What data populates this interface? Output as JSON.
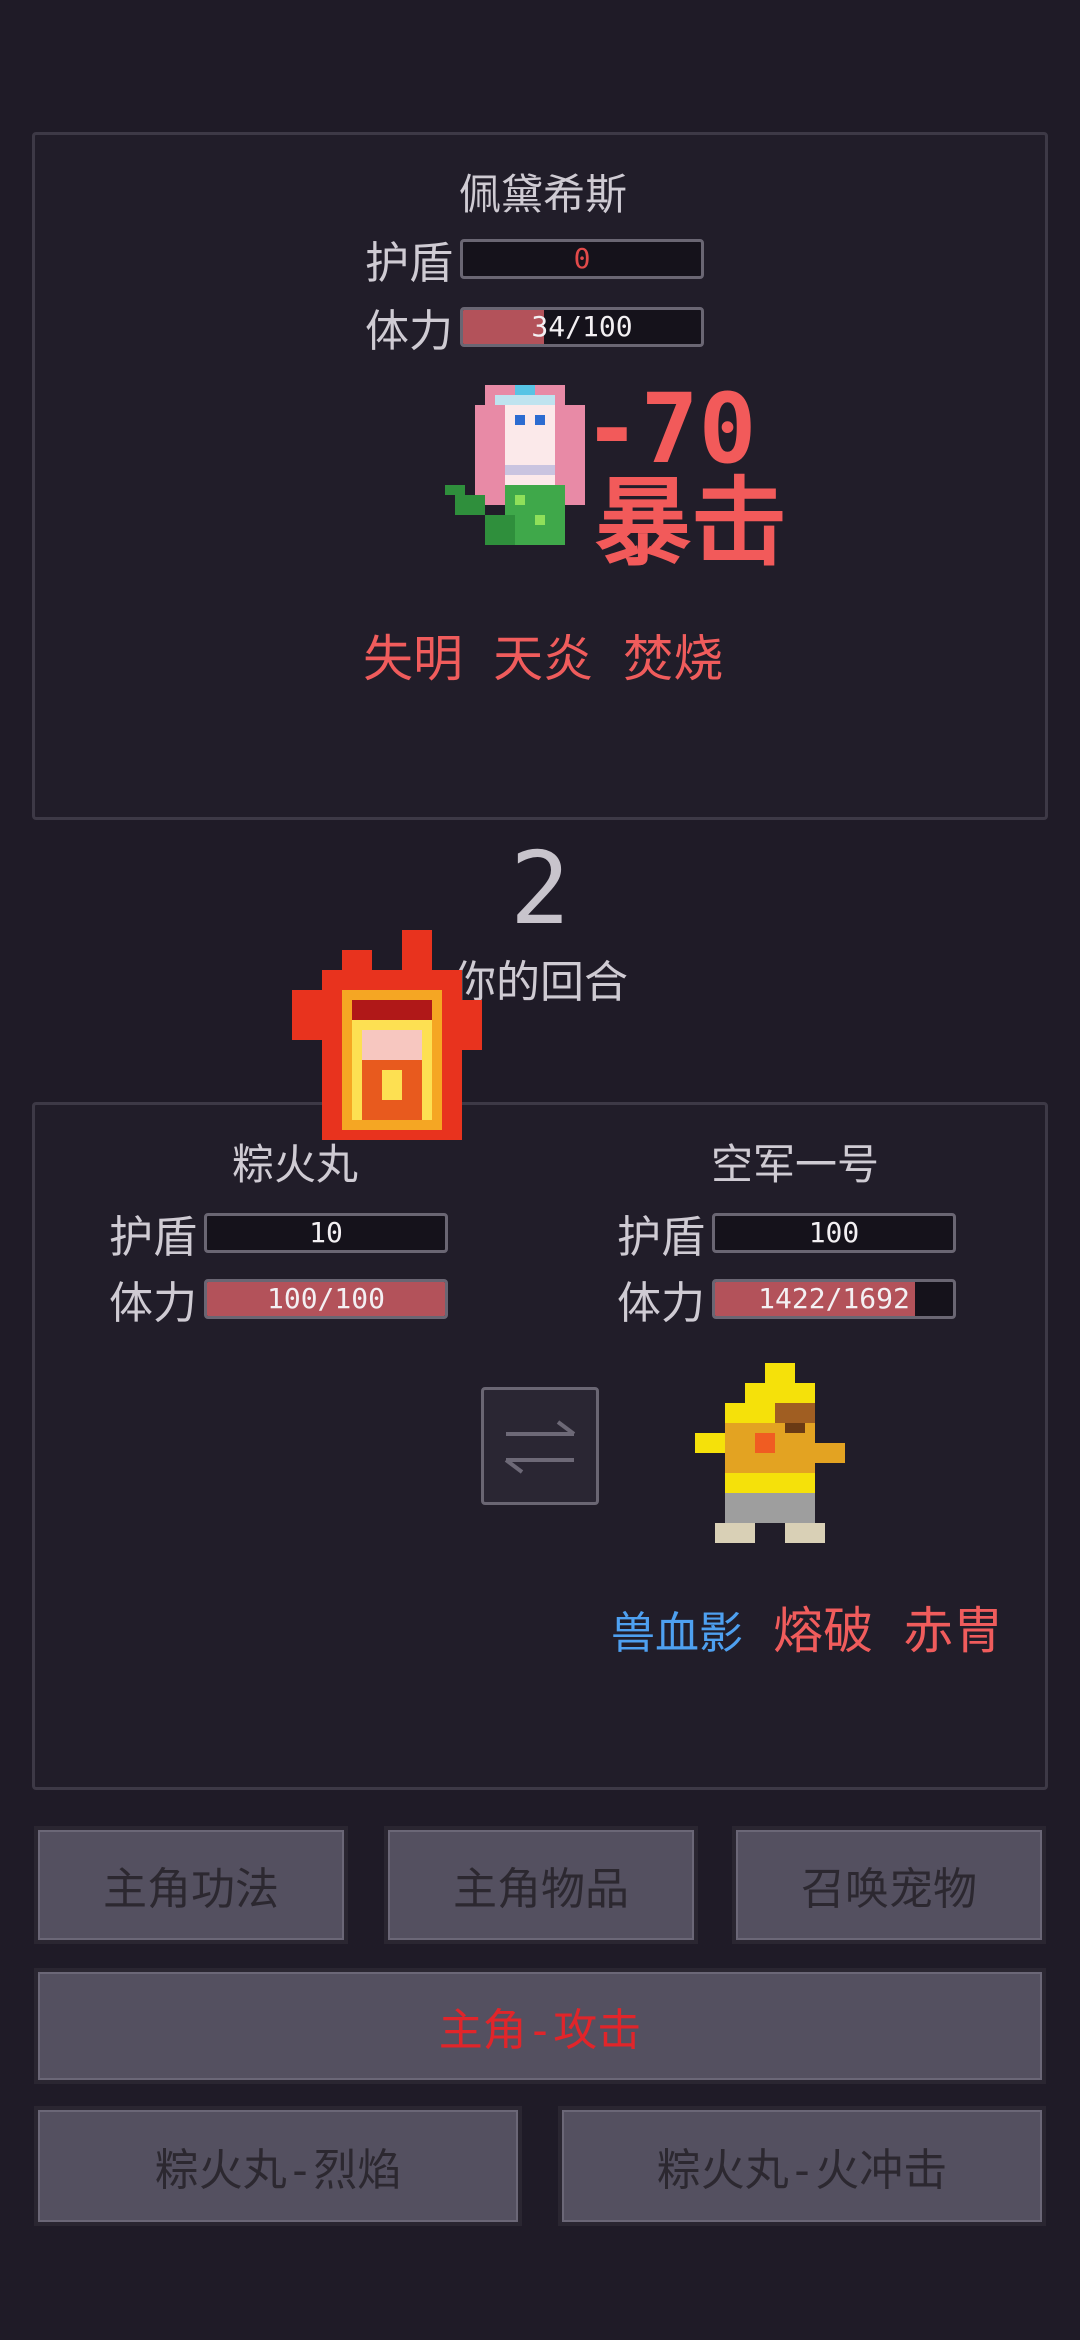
{
  "enemy": {
    "name": "佩黛希斯",
    "shield_label": "护盾",
    "shield_value": "0",
    "hp_label": "体力",
    "hp_value": "34/100",
    "hp_fraction": 0.34,
    "damage": "-70",
    "crit": "暴击",
    "effects": [
      "失明",
      "天炎",
      "焚烧"
    ]
  },
  "turn": {
    "number": "2",
    "text": "你的回合"
  },
  "pet": {
    "name": "粽火丸",
    "shield_label": "护盾",
    "shield_value": "10",
    "hp_label": "体力",
    "hp_value": "100/100",
    "hp_fraction": 1.0
  },
  "hero": {
    "name": "空军一号",
    "shield_label": "护盾",
    "shield_value": "100",
    "hp_label": "体力",
    "hp_value": "1422/1692",
    "hp_fraction": 0.84,
    "effect_blue": "兽血影",
    "effects": [
      "熔破",
      "赤冑"
    ]
  },
  "buttons": {
    "skills": "主角功法",
    "items": "主角物品",
    "summon": "召唤宠物",
    "attack": "主角-攻击",
    "pet_skill1": "粽火丸-烈焰",
    "pet_skill2": "粽火丸-火冲击"
  },
  "icons": {
    "swap": "swap-arrows-icon"
  }
}
